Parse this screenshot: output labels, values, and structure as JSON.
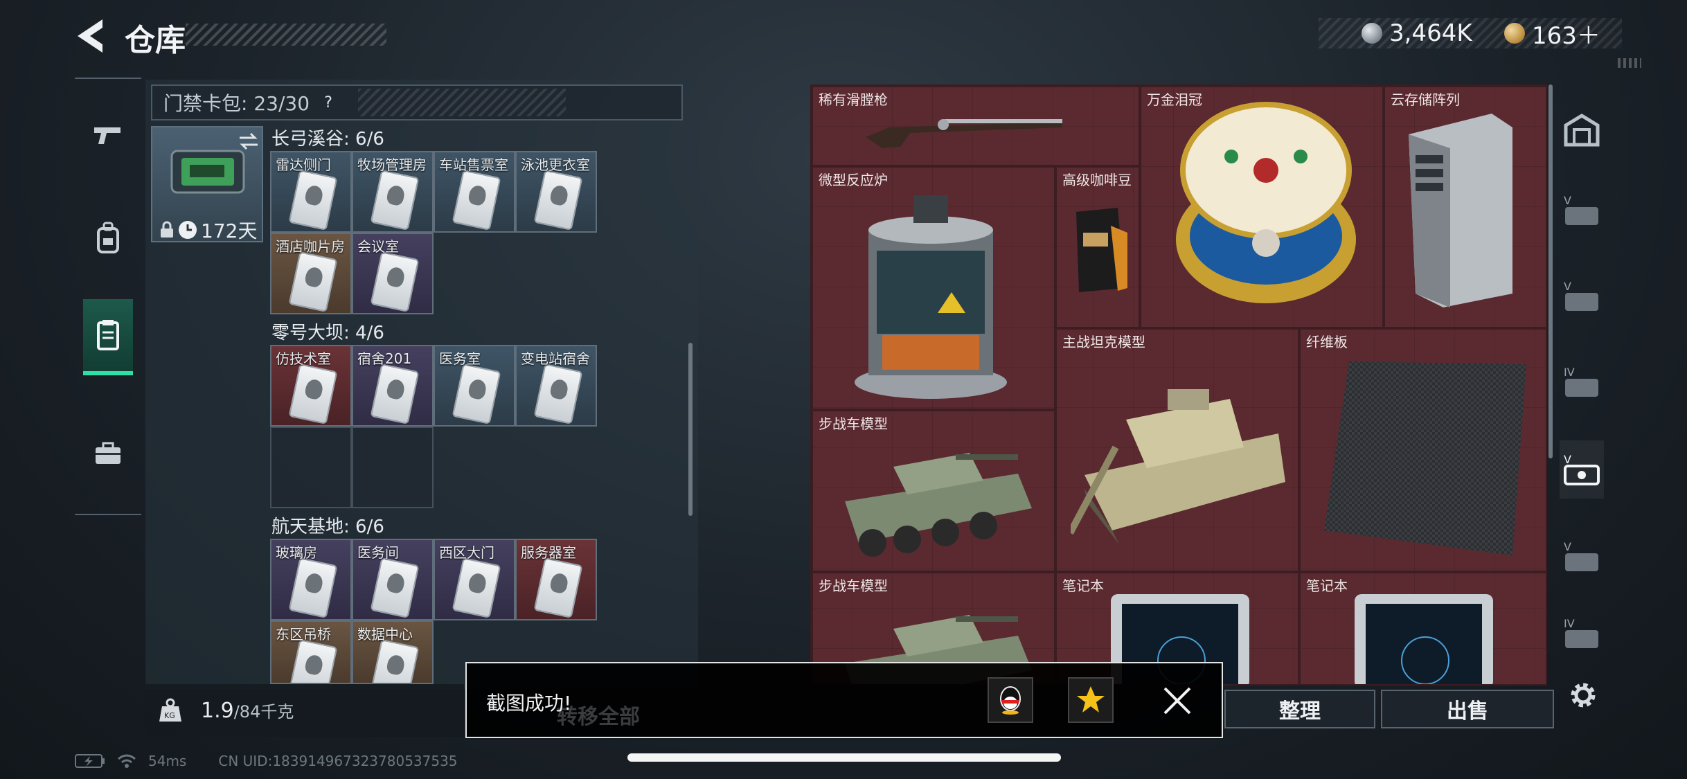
{
  "header": {
    "title": "仓库"
  },
  "currency": [
    {
      "icon": "silver-coin-icon",
      "amount": "3,464K"
    },
    {
      "icon": "gold-coin-icon",
      "amount": "163＋"
    }
  ],
  "left_nav": [
    {
      "icon": "gun-icon"
    },
    {
      "icon": "backpack-icon"
    },
    {
      "icon": "keycard-case-icon",
      "active": true
    },
    {
      "icon": "briefcase-icon"
    }
  ],
  "card_bag": {
    "label": "门禁卡包: 23/30",
    "help": "?"
  },
  "case": {
    "days": "172天"
  },
  "groups": [
    {
      "title": "长弓溪谷: 6/6",
      "cards": [
        "雷达侧门",
        "牧场管理房",
        "车站售票室",
        "泳池更衣室",
        "酒店咖片房",
        "会议室"
      ]
    },
    {
      "title": "零号大坝: 4/6",
      "cards": [
        "仿技术室",
        "宿舍201",
        "医务室",
        "变电站宿舍"
      ]
    },
    {
      "title": "航天基地: 6/6",
      "cards": [
        "玻璃房",
        "医务间",
        "西区大门",
        "服务器室",
        "东区吊桥",
        "数据中心"
      ]
    }
  ],
  "items": [
    {
      "name": "稀有滑膛枪"
    },
    {
      "name": "万金泪冠"
    },
    {
      "name": "云存储阵列"
    },
    {
      "name": "微型反应炉"
    },
    {
      "name": "高级咖啡豆"
    },
    {
      "name": "主战坦克模型"
    },
    {
      "name": "纤维板"
    },
    {
      "name": "步战车模型"
    },
    {
      "name": "步战车模型"
    },
    {
      "name": "笔记本"
    },
    {
      "name": "笔记本"
    }
  ],
  "right_tabs": [
    "vault-icon",
    "v-case-icon",
    "v-case-icon",
    "iv-case-icon",
    "v-case-active-icon",
    "v-case-icon",
    "iv-case-icon"
  ],
  "bottom": {
    "capacity_value": "1.9",
    "capacity_total": "/84千克",
    "transfer_all": "转移全部",
    "sort": "整理",
    "sell": "出售"
  },
  "toast": {
    "text": "截图成功!",
    "close": "close-icon"
  },
  "status": {
    "ping": "54ms",
    "uid": "CN UID:183914967323780537535"
  },
  "colors": {
    "accent": "#2ee0a8",
    "item_bg": "#5a2a30"
  }
}
